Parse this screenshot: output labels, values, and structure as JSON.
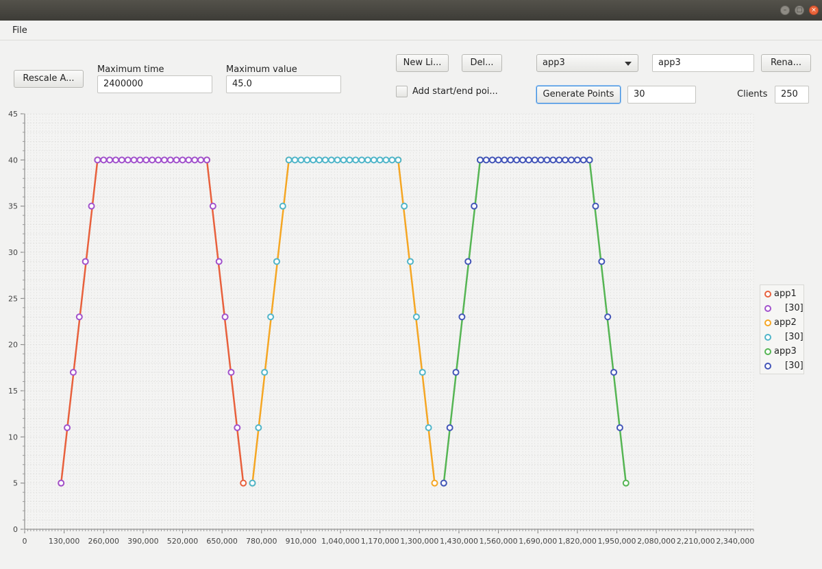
{
  "window": {
    "controls": [
      "–",
      "□",
      "×"
    ]
  },
  "menu": {
    "file": "File"
  },
  "toolbar": {
    "rescale_label": "Rescale A...",
    "max_time_label": "Maximum time",
    "max_time_value": "2400000",
    "max_value_label": "Maximum value",
    "max_value_value": "45.0",
    "new_line_label": "New Li...",
    "delete_label": "Del...",
    "series_select": "app3",
    "series_name_value": "app3",
    "rename_label": "Rena...",
    "add_points_label": "Add start/end poi...",
    "generate_label": "Generate Points",
    "generate_count": "30",
    "clients_label": "Clients",
    "clients_value": "250"
  },
  "legend": [
    {
      "name": "app1",
      "color": "#e8603c"
    },
    {
      "name": "[30]",
      "color": "#a151cc"
    },
    {
      "name": "app2",
      "color": "#f5a623"
    },
    {
      "name": "[30]",
      "color": "#4fb5c9"
    },
    {
      "name": "app3",
      "color": "#55b553"
    },
    {
      "name": "[30]",
      "color": "#4355b8"
    }
  ],
  "chart_data": {
    "type": "line",
    "xlabel": "",
    "ylabel": "",
    "xlim": [
      0,
      2400000
    ],
    "ylim": [
      0,
      45
    ],
    "grid": true,
    "legend_position": "right",
    "x_ticks": [
      "0",
      "130,000",
      "260,000",
      "390,000",
      "520,000",
      "650,000",
      "780,000",
      "910,000",
      "1,040,000",
      "1,170,000",
      "1,300,000",
      "1,430,000",
      "1,560,000",
      "1,690,000",
      "1,820,000",
      "1,950,000",
      "2,080,000",
      "2,210,000",
      "2,340,000"
    ],
    "y_ticks": [
      "0",
      "5",
      "10",
      "15",
      "20",
      "25",
      "30",
      "35",
      "40",
      "45"
    ],
    "series": [
      {
        "name": "app1",
        "color": "#e8603c",
        "points": [
          [
            120000,
            5
          ],
          [
            240000,
            40
          ],
          [
            600000,
            40
          ],
          [
            720000,
            5
          ]
        ]
      },
      {
        "name": "[30]",
        "color": "#a151cc",
        "points": [
          [
            120000,
            5
          ],
          [
            140000,
            11
          ],
          [
            160000,
            17
          ],
          [
            180000,
            23
          ],
          [
            200000,
            29
          ],
          [
            220000,
            35
          ],
          [
            240000,
            40
          ],
          [
            260000,
            40
          ],
          [
            280000,
            40
          ],
          [
            300000,
            40
          ],
          [
            320000,
            40
          ],
          [
            340000,
            40
          ],
          [
            360000,
            40
          ],
          [
            380000,
            40
          ],
          [
            400000,
            40
          ],
          [
            420000,
            40
          ],
          [
            440000,
            40
          ],
          [
            460000,
            40
          ],
          [
            480000,
            40
          ],
          [
            500000,
            40
          ],
          [
            520000,
            40
          ],
          [
            540000,
            40
          ],
          [
            560000,
            40
          ],
          [
            580000,
            40
          ],
          [
            600000,
            40
          ],
          [
            620000,
            35
          ],
          [
            640000,
            29
          ],
          [
            660000,
            23
          ],
          [
            680000,
            17
          ],
          [
            700000,
            11
          ]
        ]
      },
      {
        "name": "app2",
        "color": "#f5a623",
        "points": [
          [
            750000,
            5
          ],
          [
            870000,
            40
          ],
          [
            1230000,
            40
          ],
          [
            1350000,
            5
          ]
        ]
      },
      {
        "name": "[30]",
        "color": "#4fb5c9",
        "points": [
          [
            750000,
            5
          ],
          [
            770000,
            11
          ],
          [
            790000,
            17
          ],
          [
            810000,
            23
          ],
          [
            830000,
            29
          ],
          [
            850000,
            35
          ],
          [
            870000,
            40
          ],
          [
            890000,
            40
          ],
          [
            910000,
            40
          ],
          [
            930000,
            40
          ],
          [
            950000,
            40
          ],
          [
            970000,
            40
          ],
          [
            990000,
            40
          ],
          [
            1010000,
            40
          ],
          [
            1030000,
            40
          ],
          [
            1050000,
            40
          ],
          [
            1070000,
            40
          ],
          [
            1090000,
            40
          ],
          [
            1110000,
            40
          ],
          [
            1130000,
            40
          ],
          [
            1150000,
            40
          ],
          [
            1170000,
            40
          ],
          [
            1190000,
            40
          ],
          [
            1210000,
            40
          ],
          [
            1230000,
            40
          ],
          [
            1250000,
            35
          ],
          [
            1270000,
            29
          ],
          [
            1290000,
            23
          ],
          [
            1310000,
            17
          ],
          [
            1330000,
            11
          ]
        ]
      },
      {
        "name": "app3",
        "color": "#55b553",
        "points": [
          [
            1380000,
            5
          ],
          [
            1500000,
            40
          ],
          [
            1860000,
            40
          ],
          [
            1980000,
            5
          ]
        ]
      },
      {
        "name": "[30]",
        "color": "#4355b8",
        "points": [
          [
            1380000,
            5
          ],
          [
            1400000,
            11
          ],
          [
            1420000,
            17
          ],
          [
            1440000,
            23
          ],
          [
            1460000,
            29
          ],
          [
            1480000,
            35
          ],
          [
            1500000,
            40
          ],
          [
            1520000,
            40
          ],
          [
            1540000,
            40
          ],
          [
            1560000,
            40
          ],
          [
            1580000,
            40
          ],
          [
            1600000,
            40
          ],
          [
            1620000,
            40
          ],
          [
            1640000,
            40
          ],
          [
            1660000,
            40
          ],
          [
            1680000,
            40
          ],
          [
            1700000,
            40
          ],
          [
            1720000,
            40
          ],
          [
            1740000,
            40
          ],
          [
            1760000,
            40
          ],
          [
            1780000,
            40
          ],
          [
            1800000,
            40
          ],
          [
            1820000,
            40
          ],
          [
            1840000,
            40
          ],
          [
            1860000,
            40
          ],
          [
            1880000,
            35
          ],
          [
            1900000,
            29
          ],
          [
            1920000,
            23
          ],
          [
            1940000,
            17
          ],
          [
            1960000,
            11
          ]
        ]
      }
    ]
  }
}
